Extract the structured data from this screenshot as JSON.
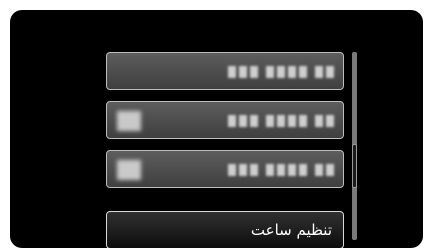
{
  "menu": {
    "items": [
      {
        "has_icon": false,
        "label": "",
        "selected": false
      },
      {
        "has_icon": true,
        "label": "",
        "selected": false
      },
      {
        "has_icon": true,
        "label": "",
        "selected": false
      },
      {
        "has_icon": false,
        "label": "تنظيم ساعت",
        "selected": true
      }
    ]
  },
  "scrollbar": {
    "position": 0.5
  },
  "colors": {
    "background": "#000000",
    "item": "#4e4e4e",
    "selected_item": "#141414",
    "item_border": "#bdbdbd"
  }
}
